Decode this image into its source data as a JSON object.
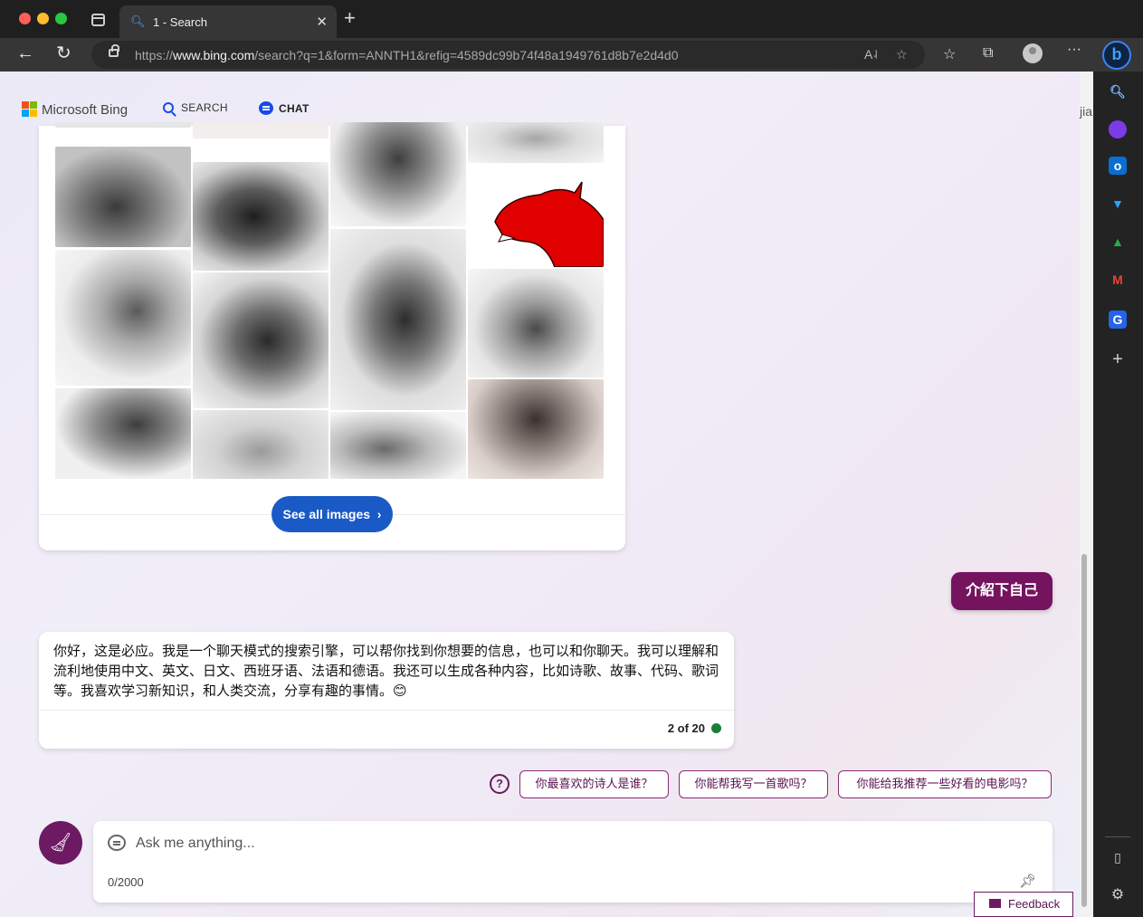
{
  "browser": {
    "tab_title": "1 - Search",
    "url_prefix": "https://",
    "url_domain": "www.bing.com",
    "url_path": "/search?q=1&form=ANNTH1&refig=4589dc99b74f48a1949761d8b7e2d4d0"
  },
  "header": {
    "brand": "Microsoft Bing",
    "nav_search": "SEARCH",
    "nav_chat": "CHAT",
    "right_cut": "jia"
  },
  "images": {
    "see_all_label": "See all images"
  },
  "conversation": {
    "user_message": "介紹下自己",
    "bot_message": "你好，这是必应。我是一个聊天模式的搜索引擎，可以帮你找到你想要的信息，也可以和你聊天。我可以理解和流利地使用中文、英文、日文、西班牙语、法语和德语。我还可以生成各种内容，比如诗歌、故事、代码、歌词等。我喜欢学习新知识，和人类交流，分享有趣的事情。😊",
    "turn_counter": "2 of 20"
  },
  "suggestions": [
    "你最喜欢的诗人是谁？",
    "你能帮我写一首歌吗？",
    "你能给我推荐一些好看的电影吗？"
  ],
  "input": {
    "placeholder": "Ask me anything...",
    "char_counter": "0/2000"
  },
  "feedback_label": "Feedback",
  "colors": {
    "accent_purple": "#75135f",
    "bing_blue": "#174ae4",
    "see_all_blue": "#1a5ac7",
    "status_green": "#1b7f37"
  }
}
